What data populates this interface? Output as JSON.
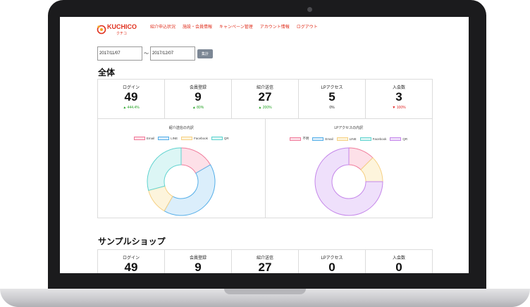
{
  "nav": {
    "logo_text": "KUCHICO",
    "logo_sub": "クチコ",
    "menu": [
      "紹介申込状況",
      "施設・会員情報",
      "キャンペーン管理",
      "アカウント情報",
      "ログアウト"
    ]
  },
  "filter": {
    "date_from": "2017/11/07",
    "separator": "〜",
    "date_to": "2017/12/07",
    "aggregate_label": "集計"
  },
  "overall": {
    "title": "全体",
    "stats": [
      {
        "label": "ログイン",
        "value": "49",
        "change": "▲ 444.4%",
        "trend": "up"
      },
      {
        "label": "会員登録",
        "value": "9",
        "change": "▲ 80%",
        "trend": "up"
      },
      {
        "label": "紹介送信",
        "value": "27",
        "change": "▲ 200%",
        "trend": "up"
      },
      {
        "label": "LPアクセス",
        "value": "5",
        "change": "0%",
        "trend": "neutral"
      },
      {
        "label": "入会数",
        "value": "3",
        "change": "▼ 100%",
        "trend": "down"
      }
    ]
  },
  "colors": {
    "email": {
      "fill": "#fde0e8",
      "stroke": "#f07a9a"
    },
    "line": {
      "fill": "#dbeefb",
      "stroke": "#54aee8"
    },
    "facebook": {
      "fill": "#fdf4dc",
      "stroke": "#f6d083"
    },
    "qr": {
      "fill": "#dcf6f5",
      "stroke": "#5fd3cf"
    },
    "unknown": {
      "fill": "#fde0e8",
      "stroke": "#f07a9a"
    },
    "lp_email": {
      "fill": "#dbeefb",
      "stroke": "#54aee8"
    },
    "lp_line": {
      "fill": "#fdf4dc",
      "stroke": "#f6d083"
    },
    "lp_facebook": {
      "fill": "#dcf6f5",
      "stroke": "#5fd3cf"
    },
    "lp_qr": {
      "fill": "#efe0fb",
      "stroke": "#c586ea"
    }
  },
  "chart_data": [
    {
      "type": "pie",
      "title": "紹介送信の内訳",
      "labels": [
        "Email",
        "LINE",
        "Facebook",
        "QR"
      ],
      "values": [
        4,
        10,
        3,
        7
      ],
      "color_keys": [
        "email",
        "line",
        "facebook",
        "qr"
      ],
      "donut": true
    },
    {
      "type": "pie",
      "title": "LPアクセスの内訳",
      "labels": [
        "不明",
        "Email",
        "LINE",
        "Facebook",
        "QR"
      ],
      "values": [
        1,
        0,
        1,
        0,
        6
      ],
      "color_keys": [
        "unknown",
        "lp_email",
        "lp_line",
        "lp_facebook",
        "lp_qr"
      ],
      "donut": true
    }
  ],
  "sample_shop": {
    "title": "サンプルショップ",
    "stats": [
      {
        "label": "ログイン",
        "value": "49"
      },
      {
        "label": "会員登録",
        "value": "9"
      },
      {
        "label": "紹介送信",
        "value": "27"
      },
      {
        "label": "LPアクセス",
        "value": "0"
      },
      {
        "label": "入会数",
        "value": "0"
      }
    ]
  }
}
